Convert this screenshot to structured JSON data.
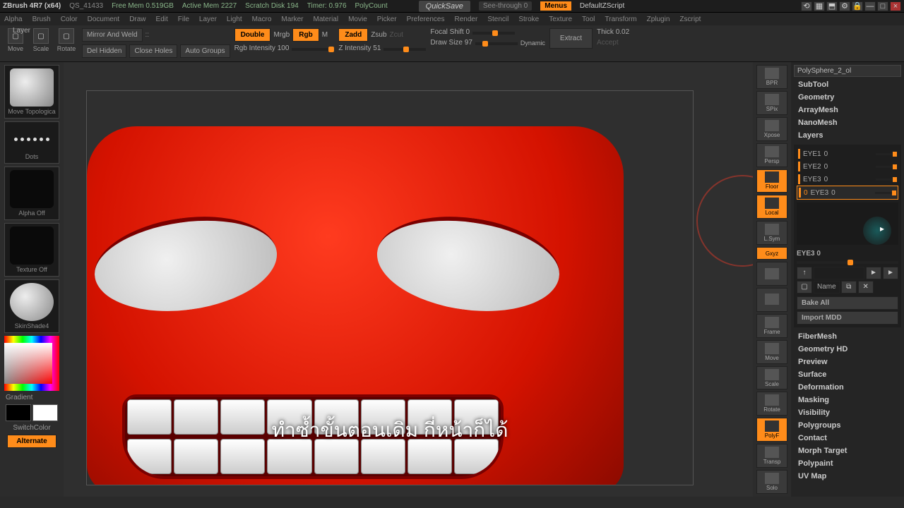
{
  "app": {
    "title": "ZBrush 4R7 (x64)",
    "doc": "QS_41433",
    "freemem": "Free Mem 0.519GB",
    "activemem": "Active Mem 2227",
    "scratch": "Scratch Disk 194",
    "timer": "Timer: 0.976",
    "polycount": "PolyCount",
    "quicksave": "QuickSave",
    "seethrough": "See-through  0",
    "menus": "Menus",
    "script": "DefaultZScript"
  },
  "menubar": [
    "Alpha",
    "Brush",
    "Color",
    "Document",
    "Draw",
    "Edit",
    "File",
    "Layer",
    "Light",
    "Macro",
    "Marker",
    "Material",
    "Movie",
    "Picker",
    "Preferences",
    "Render",
    "Stencil",
    "Stroke",
    "Texture",
    "Tool",
    "Transform",
    "Zplugin",
    "Zscript"
  ],
  "layer_label": "Layer",
  "tb_icons": [
    {
      "name": "move",
      "label": "Move"
    },
    {
      "name": "scale",
      "label": "Scale"
    },
    {
      "name": "rotate",
      "label": "Rotate"
    }
  ],
  "tb": {
    "mirror": "Mirror And Weld",
    "delhidden": "Del Hidden",
    "closeholes": "Close Holes",
    "autogroups": "Auto Groups",
    "double": "Double",
    "mrgb": "Mrgb",
    "rgb": "Rgb",
    "m": "M",
    "zadd": "Zadd",
    "zsub": "Zsub",
    "zcut": "Zcut",
    "rgbint": "Rgb Intensity 100",
    "zint": "Z Intensity 51",
    "focal": "Focal Shift 0",
    "drawsize": "Draw Size 97",
    "dynamic": "Dynamic",
    "extract": "Extract",
    "thick": "Thick 0.02",
    "accept": "Accept"
  },
  "left": {
    "brush": "Move Topologica",
    "dots": "Dots",
    "alphaoff": "Alpha Off",
    "textureoff": "Texture Off",
    "material": "SkinShade4",
    "gradient": "Gradient",
    "switch": "SwitchColor",
    "alternate": "Alternate"
  },
  "righttools": [
    {
      "n": "bpr",
      "l": "BPR"
    },
    {
      "n": "spix",
      "l": "SPix"
    },
    {
      "n": "xpose",
      "l": "Xpose"
    },
    {
      "n": "persp",
      "l": "Persp"
    },
    {
      "n": "floor",
      "l": "Floor",
      "or": true
    },
    {
      "n": "local",
      "l": "Local",
      "or": true
    },
    {
      "n": "lsym",
      "l": "L.Sym"
    },
    {
      "n": "gxyz",
      "l": "Gxyz",
      "or": true,
      "sm": true
    },
    {
      "n": "eye",
      "l": ""
    },
    {
      "n": "target",
      "l": ""
    },
    {
      "n": "frame",
      "l": "Frame"
    },
    {
      "n": "move2",
      "l": "Move"
    },
    {
      "n": "scale2",
      "l": "Scale"
    },
    {
      "n": "rotate2",
      "l": "Rotate"
    },
    {
      "n": "polyf",
      "l": "PolyF",
      "or": true
    },
    {
      "n": "transp",
      "l": "Transp"
    },
    {
      "n": "solo",
      "l": "Solo"
    }
  ],
  "rightpanel": {
    "subtool_name": "PolySphere_2_ol",
    "items_top": [
      "SubTool",
      "Geometry",
      "ArrayMesh",
      "NanoMesh",
      "Layers"
    ],
    "layers": [
      {
        "name": "EYE1",
        "val": "0"
      },
      {
        "name": "EYE2",
        "val": "0"
      },
      {
        "name": "EYE3",
        "val": "0"
      },
      {
        "name": "EYE3",
        "val": "0",
        "sel": true
      }
    ],
    "current": "EYE3 0",
    "name_lbl": "Name",
    "bake": "Bake All",
    "import": "Import MDD",
    "items_bot": [
      "FiberMesh",
      "Geometry HD",
      "Preview",
      "Surface",
      "Deformation",
      "Masking",
      "Visibility",
      "Polygroups",
      "Contact",
      "Morph Target",
      "Polypaint",
      "UV Map"
    ]
  },
  "caption": "ทำซ้ำขั้นตอนเดิม  กี่หน้าก็ได้"
}
